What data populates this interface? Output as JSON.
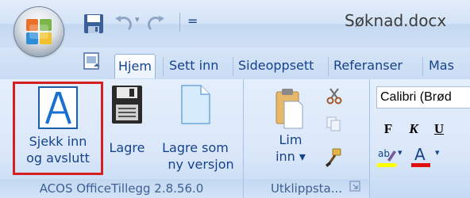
{
  "window": {
    "doc_title": "Søknad.docx"
  },
  "qat": {
    "undo_dropdown": "▾",
    "customize": "="
  },
  "tabs": [
    {
      "label": "Hjem",
      "active": true
    },
    {
      "label": "Sett inn"
    },
    {
      "label": "Sideoppsett"
    },
    {
      "label": "Referanser"
    },
    {
      "label": "Mas"
    }
  ],
  "groups": {
    "acos": {
      "label": "ACOS OfficeTillegg 2.8.56.0",
      "checkin": {
        "line1": "Sjekk inn",
        "line2": "og avslutt"
      },
      "save": {
        "line1": "Lagre"
      },
      "save_as_new": {
        "line1": "Lagre som",
        "line2": "ny versjon"
      }
    },
    "clipboard": {
      "label": "Utklippsta...",
      "paste": {
        "line1": "Lim",
        "line2": "inn ▾"
      }
    },
    "font": {
      "font_name": "Calibri (Brød",
      "bold": "F",
      "italic": "K",
      "underline": "U",
      "dropdown_arrow": "▾"
    }
  },
  "colors": {
    "accent_border": "#d42020",
    "font_color_bar": "#e01010",
    "highlight_bar": "#ffff00",
    "text": "#15428b"
  }
}
